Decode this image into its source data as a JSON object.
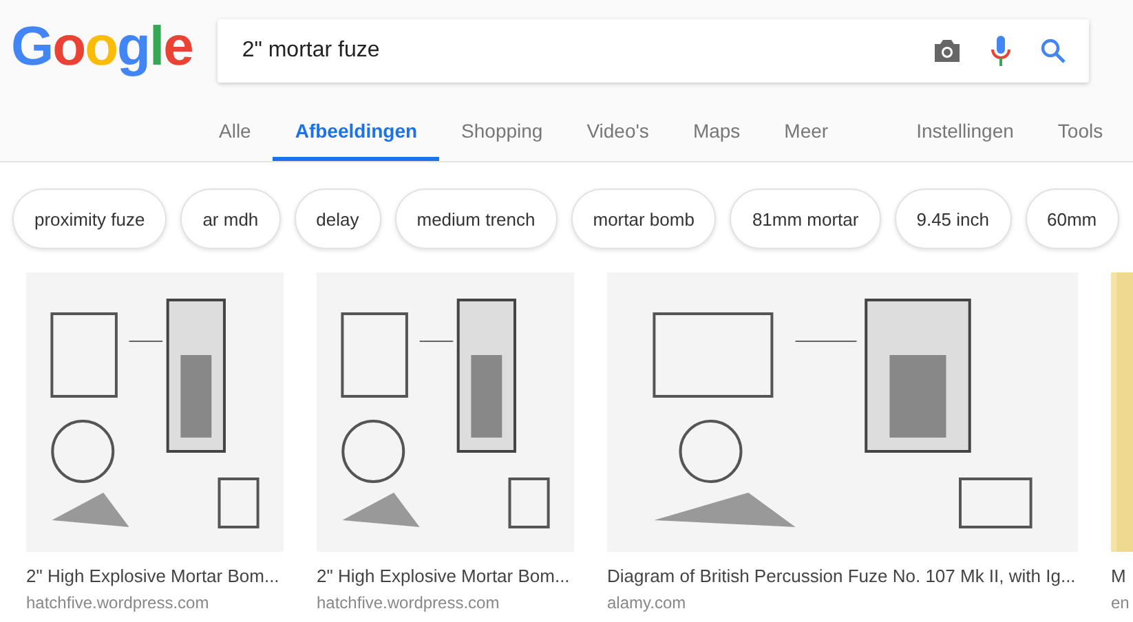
{
  "logo": "Google",
  "search": {
    "value": "2\" mortar fuze"
  },
  "tabs": [
    {
      "label": "Alle",
      "selected": false
    },
    {
      "label": "Afbeeldingen",
      "selected": true
    },
    {
      "label": "Shopping",
      "selected": false
    },
    {
      "label": "Video's",
      "selected": false
    },
    {
      "label": "Maps",
      "selected": false
    },
    {
      "label": "Meer",
      "selected": false
    }
  ],
  "tools": [
    "Instellingen",
    "Tools"
  ],
  "chips": [
    "proximity fuze",
    "ar mdh",
    "delay",
    "medium trench",
    "mortar bomb",
    "81mm mortar",
    "9.45 inch",
    "60mm"
  ],
  "results": [
    {
      "kind": "picture",
      "title": "2\" High Explosive Mortar Bom...",
      "source": "hatchfive.wordpress.com"
    },
    {
      "kind": "picture",
      "title": "2\" High Explosive Mortar Bom...",
      "source": "hatchfive.wordpress.com"
    },
    {
      "kind": "picture",
      "title": "Diagram of British Percussion Fuze No. 107 Mk II, with Ig...",
      "source": "alamy.com"
    },
    {
      "kind": "picture",
      "title": "M",
      "source": "en"
    }
  ]
}
